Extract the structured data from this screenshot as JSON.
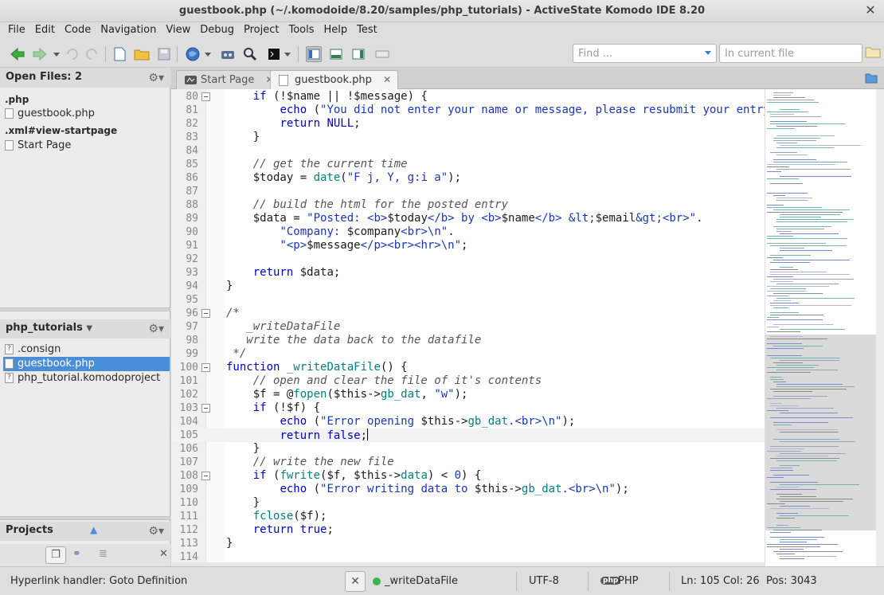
{
  "window": {
    "title": "guestbook.php (~/.komodoide/8.20/samples/php_tutorials) - ActiveState Komodo IDE 8.20"
  },
  "menu": [
    "File",
    "Edit",
    "Code",
    "Navigation",
    "View",
    "Debug",
    "Project",
    "Tools",
    "Help",
    "Test"
  ],
  "toolbar": {
    "find_placeholder": "Find ...",
    "in_placeholder": "In current file"
  },
  "open_files": {
    "title": "Open Files: 2",
    "groups": [
      {
        "label": ".php",
        "files": [
          "guestbook.php"
        ]
      },
      {
        "label": ".xml#view-startpage",
        "files": [
          "Start Page"
        ]
      }
    ]
  },
  "project": {
    "title": "php_tutorials",
    "files": [
      ".consign",
      "guestbook.php",
      "php_tutorial.komodoproject"
    ],
    "selected": "guestbook.php"
  },
  "projects_pane": {
    "title": "Projects"
  },
  "tabs": [
    {
      "label": "Start Page",
      "active": false
    },
    {
      "label": "guestbook.php",
      "active": true
    }
  ],
  "editor": {
    "lines": [
      {
        "n": "80",
        "fold": true
      },
      {
        "n": "81"
      },
      {
        "n": "82"
      },
      {
        "n": "83"
      },
      {
        "n": "84"
      },
      {
        "n": "85"
      },
      {
        "n": "86"
      },
      {
        "n": "87"
      },
      {
        "n": "88"
      },
      {
        "n": "89"
      },
      {
        "n": "90"
      },
      {
        "n": "91"
      },
      {
        "n": "92"
      },
      {
        "n": "93"
      },
      {
        "n": "94"
      },
      {
        "n": "95"
      },
      {
        "n": "96",
        "fold": true
      },
      {
        "n": "97"
      },
      {
        "n": "98"
      },
      {
        "n": "99"
      },
      {
        "n": "100",
        "fold": true
      },
      {
        "n": "101"
      },
      {
        "n": "102"
      },
      {
        "n": "103",
        "fold": true
      },
      {
        "n": "104"
      },
      {
        "n": "105"
      },
      {
        "n": "106"
      },
      {
        "n": "107"
      },
      {
        "n": "108",
        "fold": true
      },
      {
        "n": "109"
      },
      {
        "n": "110"
      },
      {
        "n": "111"
      },
      {
        "n": "112"
      },
      {
        "n": "113"
      },
      {
        "n": "114"
      }
    ]
  },
  "status": {
    "message": "Hyperlink handler: Goto Definition",
    "symbol": "_writeDataFile",
    "encoding": "UTF-8",
    "language_icon": "php",
    "language": "PHP",
    "position": "Ln: 105 Col: 26",
    "pos": "Pos: 3043"
  }
}
